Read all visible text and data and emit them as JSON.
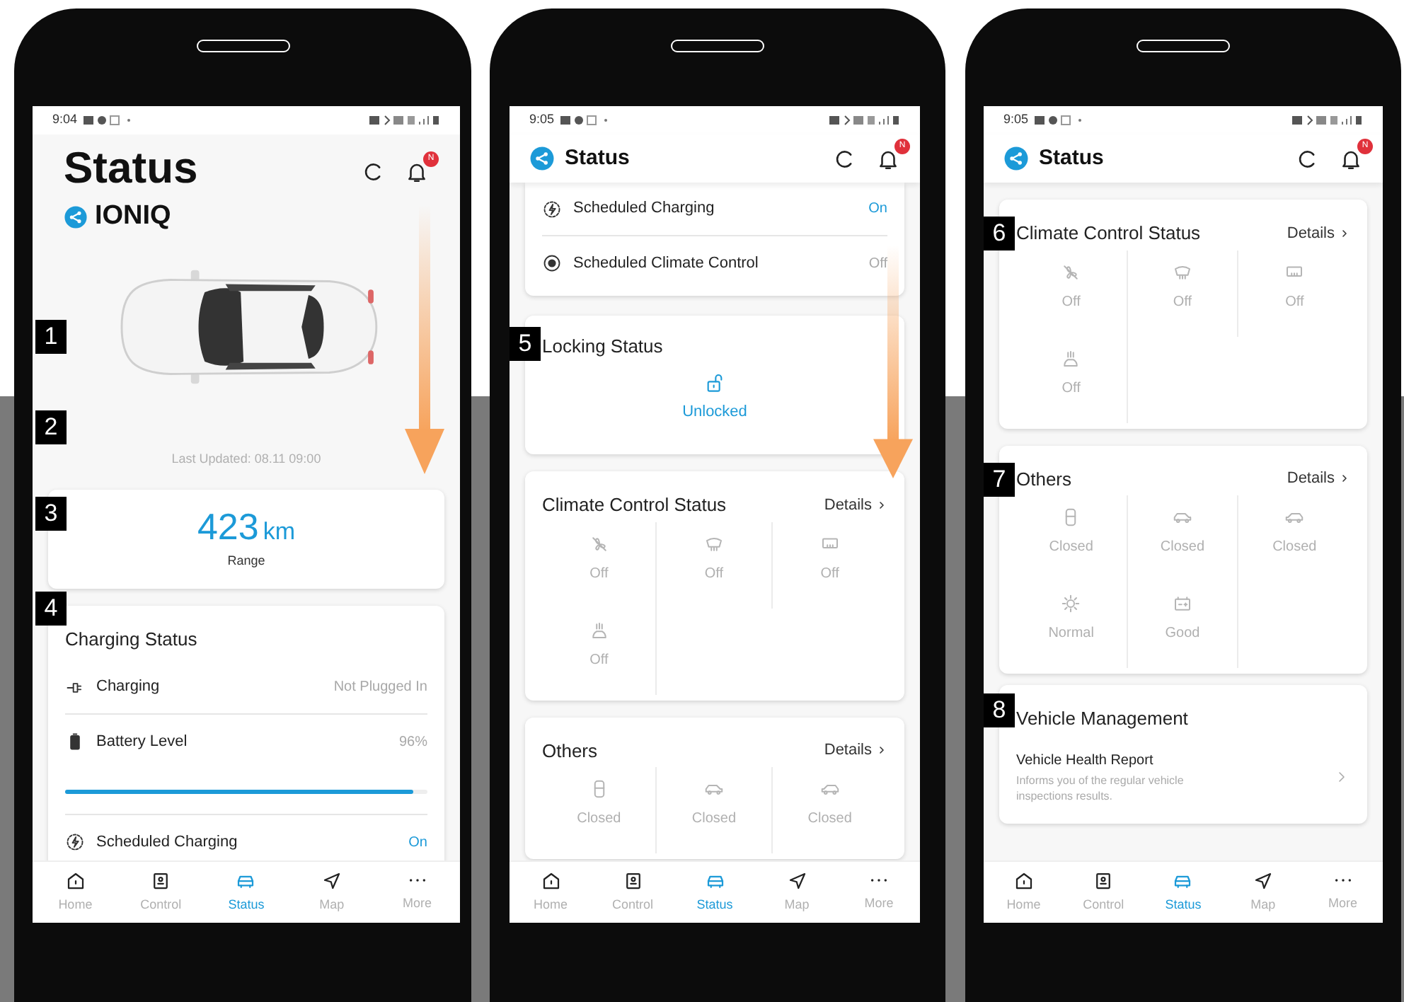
{
  "phones": [
    {
      "status_bar": {
        "time": "9:04"
      },
      "header": {
        "kind": "large",
        "title": "Status",
        "vehicle": "IONIQ",
        "badge": "N"
      },
      "scroll_arrow": true,
      "sections": [
        {
          "kind": "car",
          "marker": "1"
        },
        {
          "kind": "updated",
          "marker": "2",
          "text": "Last Updated: 08.11 09:00"
        },
        {
          "kind": "range",
          "marker": "3",
          "value": "423",
          "unit": "km",
          "label": "Range"
        },
        {
          "kind": "list",
          "marker": "4",
          "title": "Charging Status",
          "rows": [
            {
              "kind": "charging",
              "label": "Charging",
              "value": "Not Plugged In",
              "active": false
            },
            {
              "kind": "battery",
              "label": "Battery Level",
              "value": "96%",
              "active": false,
              "level": 0.96
            },
            {
              "kind": "schedule",
              "label": "Scheduled Charging",
              "value": "On",
              "active": true
            }
          ]
        }
      ],
      "nav": [
        {
          "label": "Home",
          "selected": false
        },
        {
          "label": "Control",
          "selected": false
        },
        {
          "label": "Status",
          "selected": true
        },
        {
          "label": "Map",
          "selected": false
        },
        {
          "label": "More",
          "selected": false
        }
      ]
    },
    {
      "status_bar": {
        "time": "9:05"
      },
      "header": {
        "kind": "compact",
        "title": "Status",
        "badge": "N"
      },
      "scroll_arrow": true,
      "sections": [
        {
          "kind": "list",
          "rows": [
            {
              "kind": "schedule",
              "label": "Scheduled Charging",
              "value": "On",
              "active": true
            },
            {
              "kind": "climate",
              "label": "Scheduled Climate Control",
              "value": "Off",
              "active": false
            }
          ]
        },
        {
          "kind": "lock",
          "marker": "5",
          "title": "Locking Status",
          "value": "Unlocked"
        },
        {
          "kind": "climate",
          "title": "Climate Control Status",
          "link": "Details",
          "items": [
            {
              "value": "Off"
            },
            {
              "value": "Off"
            },
            {
              "value": "Off"
            },
            {
              "value": "Off"
            }
          ]
        },
        {
          "kind": "others",
          "title": "Others",
          "link": "Details",
          "items": [
            {
              "value": "Closed"
            },
            {
              "value": "Closed"
            },
            {
              "value": "Closed"
            }
          ]
        }
      ],
      "nav": [
        {
          "label": "Home",
          "selected": false
        },
        {
          "label": "Control",
          "selected": false
        },
        {
          "label": "Status",
          "selected": true
        },
        {
          "label": "Map",
          "selected": false
        },
        {
          "label": "More",
          "selected": false
        }
      ]
    },
    {
      "status_bar": {
        "time": "9:05"
      },
      "header": {
        "kind": "compact",
        "title": "Status",
        "badge": "N"
      },
      "scroll_arrow": false,
      "sections": [
        {
          "kind": "climate",
          "marker": "6",
          "title": "Climate Control Status",
          "link": "Details",
          "items": [
            {
              "value": "Off"
            },
            {
              "value": "Off"
            },
            {
              "value": "Off"
            },
            {
              "value": "Off"
            }
          ]
        },
        {
          "kind": "others",
          "marker": "7",
          "title": "Others",
          "link": "Details",
          "items": [
            {
              "value": "Closed"
            },
            {
              "value": "Closed"
            },
            {
              "value": "Closed"
            },
            {
              "value": "Normal"
            },
            {
              "value": "Good"
            }
          ]
        },
        {
          "kind": "management",
          "marker": "8",
          "title": "Vehicle Management",
          "item_title": "Vehicle Health Report",
          "item_text": "Informs you of the regular vehicle inspections results."
        }
      ],
      "nav": [
        {
          "label": "Home",
          "selected": false
        },
        {
          "label": "Control",
          "selected": false
        },
        {
          "label": "Status",
          "selected": true
        },
        {
          "label": "Map",
          "selected": false
        },
        {
          "label": "More",
          "selected": false
        }
      ]
    }
  ]
}
